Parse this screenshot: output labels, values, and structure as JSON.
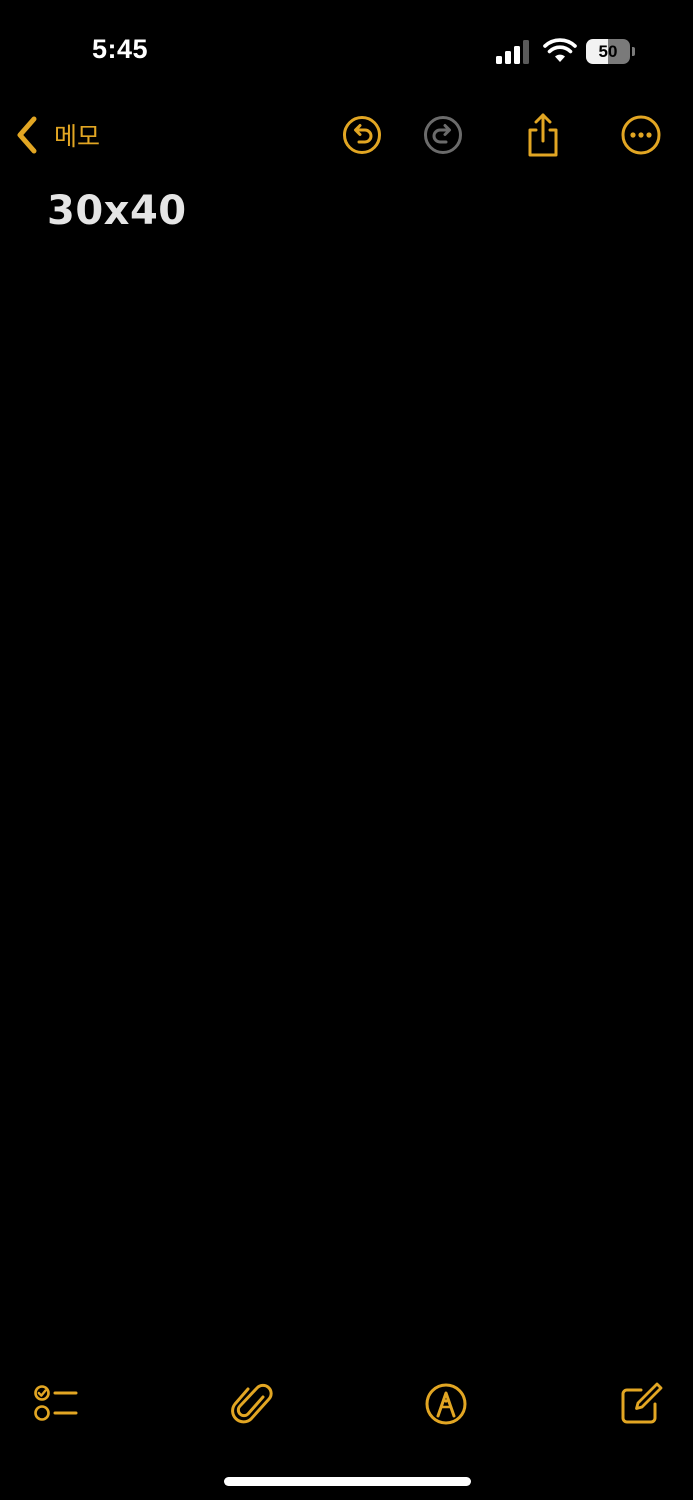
{
  "status_bar": {
    "time": "5:45",
    "battery_level": "50",
    "signal_icon": "cellular-signal-icon",
    "wifi_icon": "wifi-icon",
    "battery_icon": "battery-icon"
  },
  "nav": {
    "back_label": "메모",
    "back_icon": "chevron-left-icon",
    "undo_icon": "undo-icon",
    "redo_icon": "redo-icon",
    "share_icon": "share-icon",
    "more_icon": "ellipsis-circle-icon",
    "redo_enabled": false
  },
  "note": {
    "title": "30x40"
  },
  "toolbar": {
    "checklist_icon": "checklist-icon",
    "attachment_icon": "paperclip-icon",
    "markup_icon": "pen-tip-circle-icon",
    "compose_icon": "compose-icon"
  },
  "colors": {
    "accent": "#e2a623",
    "background": "#000000",
    "text": "#e5e5e5",
    "disabled": "#6b6b6b"
  }
}
